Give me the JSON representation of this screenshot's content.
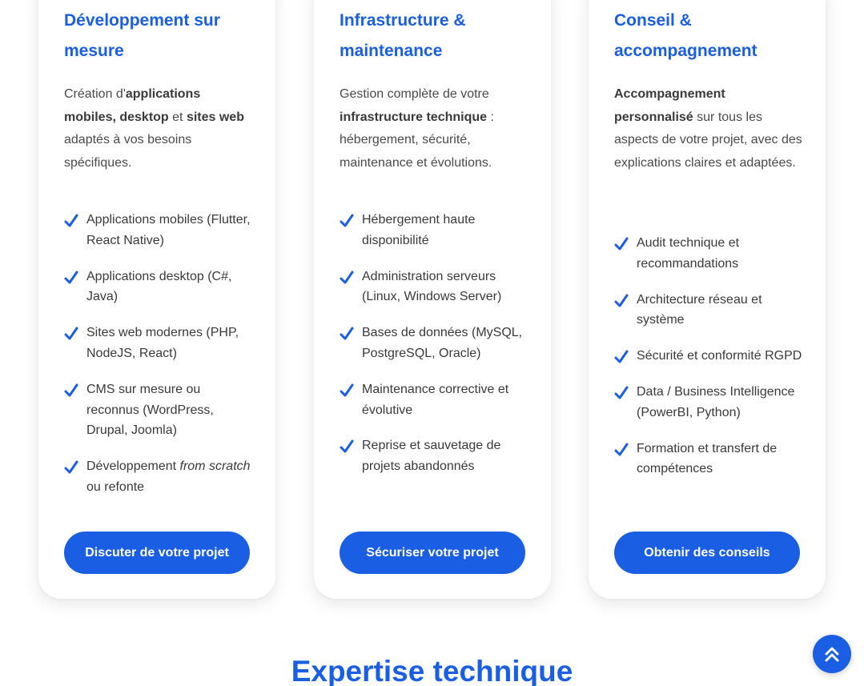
{
  "cards": [
    {
      "title": "Développement sur mesure",
      "desc_parts": [
        "Création d'",
        "applications mobiles, desktop",
        " et ",
        "sites web",
        " adaptés à vos besoins spécifiques."
      ],
      "features": [
        {
          "text": "Applications mobiles (Flutter, React Native)"
        },
        {
          "text": "Applications desktop (C#, Java)"
        },
        {
          "text": "Sites web modernes (PHP, NodeJS, React)"
        },
        {
          "text": "CMS sur mesure ou reconnus (WordPress, Drupal, Joomla)"
        },
        {
          "text_pre": "Développement ",
          "text_em": "from scratch",
          "text_post": " ou refonte"
        }
      ],
      "cta": "Discuter de votre projet"
    },
    {
      "title": "Infrastructure & maintenance",
      "desc_parts": [
        "Gestion complète de votre ",
        "infrastructure technique",
        " : hébergement, sécurité, maintenance et évolutions."
      ],
      "features": [
        {
          "text": "Hébergement haute disponibilité"
        },
        {
          "text": "Administration serveurs (Linux, Windows Server)"
        },
        {
          "text": "Bases de données (MySQL, PostgreSQL, Oracle)"
        },
        {
          "text": "Maintenance corrective et évolutive"
        },
        {
          "text": "Reprise et sauvetage de projets abandonnés"
        }
      ],
      "cta": "Sécuriser votre projet"
    },
    {
      "title": "Conseil & accompagnement",
      "desc_parts": [
        "Accompagnement personnalisé",
        " sur tous les aspects de votre projet, avec des explications claires et adaptées."
      ],
      "features": [
        {
          "text": "Audit technique et recommandations"
        },
        {
          "text": "Architecture réseau et système"
        },
        {
          "text": "Sécurité et conformité RGPD"
        },
        {
          "text": "Data / Business Intelligence (PowerBI, Python)"
        },
        {
          "text": "Formation et transfert de compétences"
        }
      ],
      "cta": "Obtenir des conseils"
    }
  ],
  "section_title": "Expertise technique",
  "icons": {
    "check": "check-icon",
    "scroll_top": "double-chevron-up-icon"
  },
  "colors": {
    "accent": "#1a5fe3",
    "text": "#3a3a3a"
  }
}
